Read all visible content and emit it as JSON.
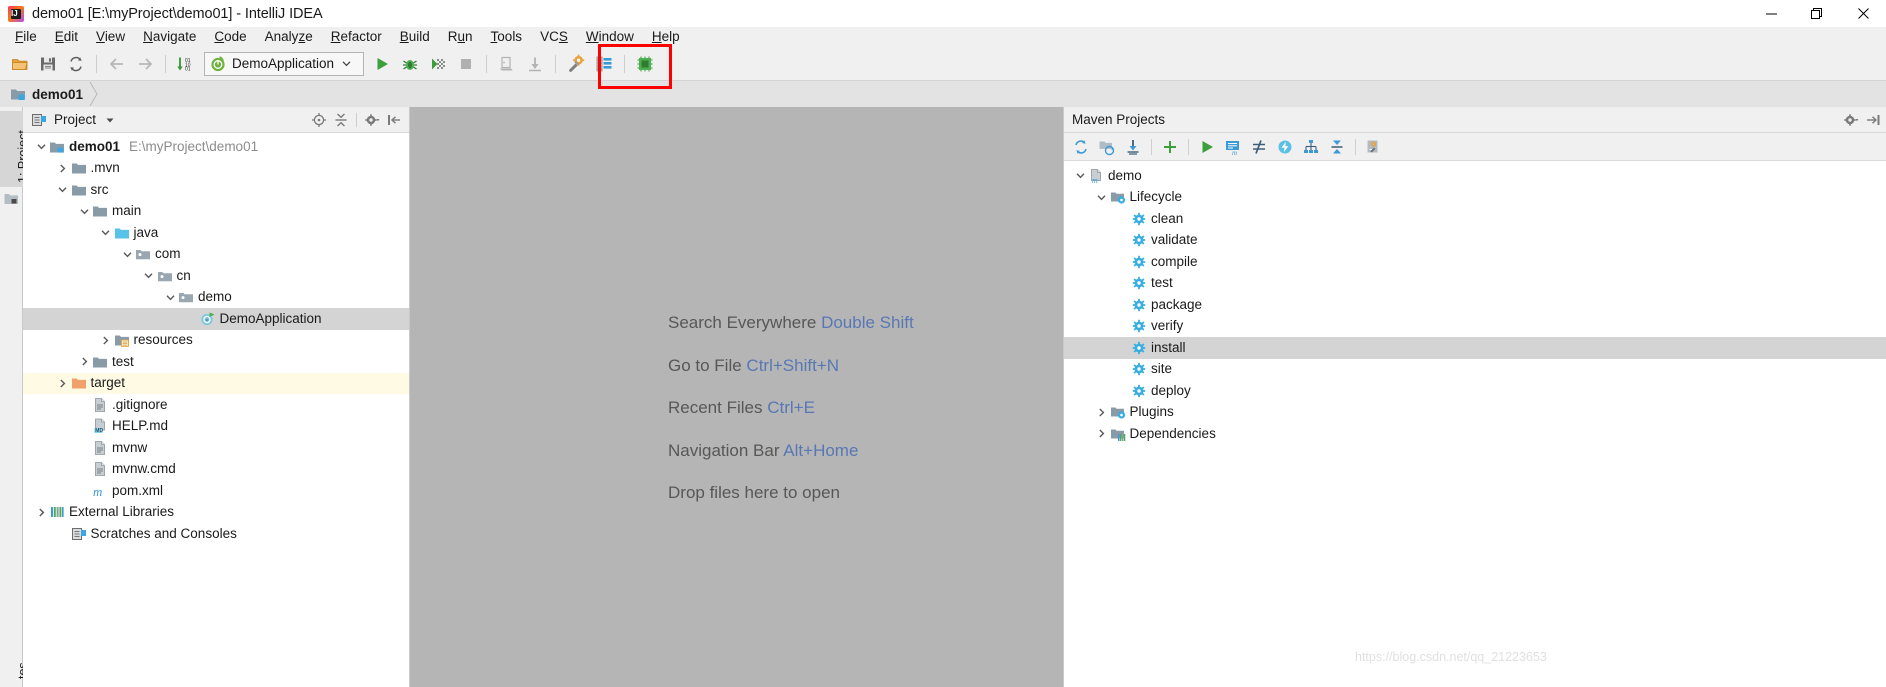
{
  "window": {
    "title": "demo01 [E:\\myProject\\demo01] - IntelliJ IDEA",
    "app_icon": "intellij-idea-icon",
    "controls": {
      "minimize": "minimize-button",
      "maximize": "maximize-button",
      "close": "close-button"
    }
  },
  "menubar": {
    "items": [
      {
        "label": "File",
        "mnemonic": "F"
      },
      {
        "label": "Edit",
        "mnemonic": "E"
      },
      {
        "label": "View",
        "mnemonic": "V"
      },
      {
        "label": "Navigate",
        "mnemonic": "N"
      },
      {
        "label": "Code",
        "mnemonic": "C"
      },
      {
        "label": "Analyze",
        "mnemonic": "z"
      },
      {
        "label": "Refactor",
        "mnemonic": "R"
      },
      {
        "label": "Build",
        "mnemonic": "B"
      },
      {
        "label": "Run",
        "mnemonic": "u"
      },
      {
        "label": "Tools",
        "mnemonic": "T"
      },
      {
        "label": "VCS",
        "mnemonic": "S"
      },
      {
        "label": "Window",
        "mnemonic": "W"
      },
      {
        "label": "Help",
        "mnemonic": "H"
      }
    ]
  },
  "toolbar": {
    "buttons": [
      {
        "name": "open-project-icon",
        "title": "Open"
      },
      {
        "name": "save-all-icon",
        "title": "Save All"
      },
      {
        "name": "synchronize-icon",
        "title": "Synchronize"
      },
      {
        "name": "back-arrow-icon",
        "title": "Back"
      },
      {
        "name": "forward-arrow-icon",
        "title": "Forward"
      },
      {
        "name": "compile-icon",
        "title": "Compile"
      }
    ],
    "run_configuration": {
      "name": "DemoApplication",
      "icon": "spring-boot-icon",
      "caret": "⌄"
    },
    "run_buttons": [
      {
        "name": "run-icon",
        "title": "Run",
        "color": "#3c9f3c"
      },
      {
        "name": "debug-icon",
        "title": "Debug",
        "color": "#4caf50"
      },
      {
        "name": "run-with-coverage-icon",
        "title": "Run with Coverage"
      },
      {
        "name": "stop-icon",
        "title": "Stop"
      }
    ],
    "right_buttons": [
      {
        "name": "update-project-icon",
        "title": "Update Project"
      },
      {
        "name": "commit-icon",
        "title": "Commit"
      },
      {
        "name": "settings-wrench-icon",
        "title": "Settings"
      },
      {
        "name": "project-structure-icon",
        "title": "Project Structure"
      },
      {
        "name": "sdk-manager-icon",
        "title": "SDK Manager"
      }
    ],
    "annotation": {
      "type": "red-rectangle",
      "color": "#ff0000",
      "covers": [
        "settings-wrench-icon",
        "project-structure-icon"
      ]
    }
  },
  "breadcrumb": {
    "items": [
      {
        "label": "demo01",
        "icon": "module-icon"
      }
    ]
  },
  "left_tool_tabs": [
    {
      "label": "1: Project",
      "active": true
    }
  ],
  "project_panel": {
    "title": "Project",
    "view_icon": "project-view-icon",
    "dropdown_caret": "▾",
    "header_buttons": [
      {
        "name": "locate-icon",
        "title": "Select Opened File"
      },
      {
        "name": "collapse-all-icon",
        "title": "Collapse All"
      },
      {
        "name": "settings-gear-icon",
        "title": "Settings"
      },
      {
        "name": "hide-panel-icon",
        "title": "Hide"
      }
    ],
    "tree": [
      {
        "label": "demo01",
        "sub": "E:\\myProject\\demo01",
        "indent": 0,
        "twisty": "down",
        "icon": "module-icon",
        "bold": true,
        "state": "normal"
      },
      {
        "label": ".mvn",
        "sub": "",
        "indent": 1,
        "twisty": "right",
        "icon": "folder-icon",
        "bold": false,
        "state": "normal"
      },
      {
        "label": "src",
        "sub": "",
        "indent": 1,
        "twisty": "down",
        "icon": "folder-icon",
        "bold": false,
        "state": "normal"
      },
      {
        "label": "main",
        "sub": "",
        "indent": 2,
        "twisty": "down",
        "icon": "folder-icon",
        "bold": false,
        "state": "normal"
      },
      {
        "label": "java",
        "sub": "",
        "indent": 3,
        "twisty": "down",
        "icon": "source-folder-icon",
        "bold": false,
        "state": "normal"
      },
      {
        "label": "com",
        "sub": "",
        "indent": 4,
        "twisty": "down",
        "icon": "package-icon",
        "bold": false,
        "state": "normal"
      },
      {
        "label": "cn",
        "sub": "",
        "indent": 5,
        "twisty": "down",
        "icon": "package-icon",
        "bold": false,
        "state": "normal"
      },
      {
        "label": "demo",
        "sub": "",
        "indent": 6,
        "twisty": "down",
        "icon": "package-icon",
        "bold": false,
        "state": "normal"
      },
      {
        "label": "DemoApplication",
        "sub": "",
        "indent": 7,
        "twisty": "none",
        "icon": "spring-class-icon",
        "bold": false,
        "state": "selected"
      },
      {
        "label": "resources",
        "sub": "",
        "indent": 3,
        "twisty": "right",
        "icon": "resources-folder-icon",
        "bold": false,
        "state": "normal"
      },
      {
        "label": "test",
        "sub": "",
        "indent": 2,
        "twisty": "right",
        "icon": "folder-icon",
        "bold": false,
        "state": "normal"
      },
      {
        "label": "target",
        "sub": "",
        "indent": 1,
        "twisty": "right",
        "icon": "excluded-folder-icon",
        "bold": false,
        "state": "highlight"
      },
      {
        "label": ".gitignore",
        "sub": "",
        "indent": 2,
        "twisty": "none",
        "icon": "file-icon",
        "bold": false,
        "state": "normal"
      },
      {
        "label": "HELP.md",
        "sub": "",
        "indent": 2,
        "twisty": "none",
        "icon": "markdown-file-icon",
        "bold": false,
        "state": "normal"
      },
      {
        "label": "mvnw",
        "sub": "",
        "indent": 2,
        "twisty": "none",
        "icon": "file-icon",
        "bold": false,
        "state": "normal"
      },
      {
        "label": "mvnw.cmd",
        "sub": "",
        "indent": 2,
        "twisty": "none",
        "icon": "file-icon",
        "bold": false,
        "state": "normal"
      },
      {
        "label": "pom.xml",
        "sub": "",
        "indent": 2,
        "twisty": "none",
        "icon": "maven-pom-icon",
        "bold": false,
        "state": "normal"
      },
      {
        "label": "External Libraries",
        "sub": "",
        "indent": 0,
        "twisty": "right",
        "icon": "libraries-icon",
        "bold": false,
        "state": "normal"
      },
      {
        "label": "Scratches and Consoles",
        "sub": "",
        "indent": 1,
        "twisty": "none",
        "icon": "scratches-icon",
        "bold": false,
        "state": "normal"
      }
    ]
  },
  "editor": {
    "background_color": "#b5b5b5",
    "hints": [
      {
        "action": "Search Everywhere",
        "shortcut": "Double Shift"
      },
      {
        "action": "Go to File",
        "shortcut": "Ctrl+Shift+N"
      },
      {
        "action": "Recent Files",
        "shortcut": "Ctrl+E"
      },
      {
        "action": "Navigation Bar",
        "shortcut": "Alt+Home"
      },
      {
        "action": "Drop files here to open",
        "shortcut": ""
      }
    ],
    "shortcut_color": "#5878b4",
    "text_color": "#575757"
  },
  "maven_panel": {
    "title": "Maven Projects",
    "header_buttons": [
      {
        "name": "settings-gear-icon",
        "title": "Settings"
      },
      {
        "name": "hide-panel-icon",
        "title": "Hide"
      }
    ],
    "toolbar_buttons": [
      {
        "name": "reimport-icon",
        "title": "Reimport All Maven Projects"
      },
      {
        "name": "generate-sources-icon",
        "title": "Generate Sources and Update Folders"
      },
      {
        "name": "download-sources-icon",
        "title": "Download Sources and/or Documentation"
      },
      {
        "name": "add-maven-project-icon",
        "title": "Add Maven Projects"
      },
      {
        "name": "run-maven-build-icon",
        "title": "Run Maven Build"
      },
      {
        "name": "execute-goal-icon",
        "title": "Execute Maven Goal"
      },
      {
        "name": "toggle-skip-tests-icon",
        "title": "Toggle Skip Tests Mode"
      },
      {
        "name": "toggle-offline-icon",
        "title": "Toggle Offline Mode"
      },
      {
        "name": "show-dependency-graph-icon",
        "title": "Show Dependencies"
      },
      {
        "name": "collapse-all-icon",
        "title": "Collapse All"
      },
      {
        "name": "maven-settings-icon",
        "title": "Maven Settings"
      }
    ],
    "tree": [
      {
        "label": "demo",
        "indent": 0,
        "twisty": "down",
        "icon": "maven-project-icon",
        "state": "normal"
      },
      {
        "label": "Lifecycle",
        "indent": 1,
        "twisty": "down",
        "icon": "lifecycle-folder-icon",
        "state": "normal"
      },
      {
        "label": "clean",
        "indent": 2,
        "twisty": "none",
        "icon": "maven-goal-icon",
        "state": "normal"
      },
      {
        "label": "validate",
        "indent": 2,
        "twisty": "none",
        "icon": "maven-goal-icon",
        "state": "normal"
      },
      {
        "label": "compile",
        "indent": 2,
        "twisty": "none",
        "icon": "maven-goal-icon",
        "state": "normal"
      },
      {
        "label": "test",
        "indent": 2,
        "twisty": "none",
        "icon": "maven-goal-icon",
        "state": "normal"
      },
      {
        "label": "package",
        "indent": 2,
        "twisty": "none",
        "icon": "maven-goal-icon",
        "state": "normal"
      },
      {
        "label": "verify",
        "indent": 2,
        "twisty": "none",
        "icon": "maven-goal-icon",
        "state": "normal"
      },
      {
        "label": "install",
        "indent": 2,
        "twisty": "none",
        "icon": "maven-goal-icon",
        "state": "selected"
      },
      {
        "label": "site",
        "indent": 2,
        "twisty": "none",
        "icon": "maven-goal-icon",
        "state": "normal"
      },
      {
        "label": "deploy",
        "indent": 2,
        "twisty": "none",
        "icon": "maven-goal-icon",
        "state": "normal"
      },
      {
        "label": "Plugins",
        "indent": 1,
        "twisty": "right",
        "icon": "plugins-folder-icon",
        "state": "normal"
      },
      {
        "label": "Dependencies",
        "indent": 1,
        "twisty": "right",
        "icon": "dependencies-folder-icon",
        "state": "normal"
      }
    ]
  },
  "watermark": {
    "text": "https://blog.csdn.net/qq_21223653"
  }
}
